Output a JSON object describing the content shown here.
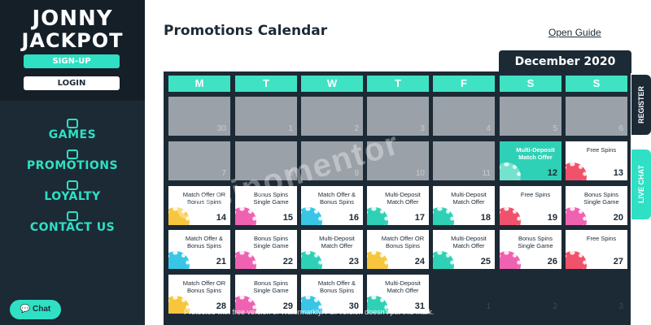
{
  "sidebar": {
    "logo_line1": "JONNY",
    "logo_line2": "JACKPOT",
    "signup_label": "SIGN-UP",
    "login_label": "LOGIN",
    "nav": [
      {
        "label": "GAMES",
        "icon": "cards-icon"
      },
      {
        "label": "PROMOTIONS",
        "icon": "gift-icon"
      },
      {
        "label": "LOYALTY",
        "icon": "trophy-icon"
      },
      {
        "label": "CONTACT US",
        "icon": "support-icon"
      }
    ],
    "chat_label": "Chat"
  },
  "header": {
    "title": "Promotions Calendar",
    "guide_link": "Open Guide",
    "month": "December 2020"
  },
  "weekdays": [
    "M",
    "T",
    "W",
    "T",
    "F",
    "S",
    "S"
  ],
  "calendar": [
    {
      "day": "30",
      "offer": "",
      "state": "past"
    },
    {
      "day": "1",
      "offer": "",
      "state": "past"
    },
    {
      "day": "2",
      "offer": "",
      "state": "past"
    },
    {
      "day": "3",
      "offer": "",
      "state": "past"
    },
    {
      "day": "4",
      "offer": "",
      "state": "past"
    },
    {
      "day": "5",
      "offer": "",
      "state": "past"
    },
    {
      "day": "6",
      "offer": "",
      "state": "past"
    },
    {
      "day": "7",
      "offer": "",
      "state": "past"
    },
    {
      "day": "8",
      "offer": "",
      "state": "past"
    },
    {
      "day": "9",
      "offer": "",
      "state": "past"
    },
    {
      "day": "10",
      "offer": "",
      "state": "past"
    },
    {
      "day": "11",
      "offer": "",
      "state": "past"
    },
    {
      "day": "12",
      "offer": "Multi-Deposit Match Offer",
      "state": "highlight",
      "chip": "#ffffff"
    },
    {
      "day": "13",
      "offer": "Free Spins",
      "state": "active",
      "chip": "#f0516b"
    },
    {
      "day": "14",
      "offer": "Match Offer OR Bonus Spins",
      "state": "active",
      "chip": "#f7c63c"
    },
    {
      "day": "15",
      "offer": "Bonus Spins Single Game",
      "state": "active",
      "chip": "#ef62b1"
    },
    {
      "day": "16",
      "offer": "Match Offer & Bonus Spins",
      "state": "active",
      "chip": "#39c6e6"
    },
    {
      "day": "17",
      "offer": "Multi-Deposit Match Offer",
      "state": "active",
      "chip": "#2fd1b6"
    },
    {
      "day": "18",
      "offer": "Multi-Deposit Match Offer",
      "state": "active",
      "chip": "#2fd1b6"
    },
    {
      "day": "19",
      "offer": "Free Spins",
      "state": "active",
      "chip": "#f0516b"
    },
    {
      "day": "20",
      "offer": "Bonus Spins Single Game",
      "state": "active",
      "chip": "#ef62b1"
    },
    {
      "day": "21",
      "offer": "Match Offer & Bonus Spins",
      "state": "active",
      "chip": "#39c6e6"
    },
    {
      "day": "22",
      "offer": "Bonus Spins Single Game",
      "state": "active",
      "chip": "#ef62b1"
    },
    {
      "day": "23",
      "offer": "Multi-Deposit Match Offer",
      "state": "active",
      "chip": "#2fd1b6"
    },
    {
      "day": "24",
      "offer": "Match Offer OR Bonus Spins",
      "state": "active",
      "chip": "#f7c63c"
    },
    {
      "day": "25",
      "offer": "Multi-Deposit Match Offer",
      "state": "active",
      "chip": "#2fd1b6"
    },
    {
      "day": "26",
      "offer": "Bonus Spins Single Game",
      "state": "active",
      "chip": "#ef62b1"
    },
    {
      "day": "27",
      "offer": "Free Spins",
      "state": "active",
      "chip": "#f0516b"
    },
    {
      "day": "28",
      "offer": "Match Offer OR Bonus Spins",
      "state": "active",
      "chip": "#f7c63c"
    },
    {
      "day": "29",
      "offer": "Bonus Spins Single Game",
      "state": "active",
      "chip": "#ef62b1"
    },
    {
      "day": "30",
      "offer": "Match Offer & Bonus Spins",
      "state": "active",
      "chip": "#39c6e6"
    },
    {
      "day": "31",
      "offer": "Multi-Deposit Match Offer",
      "state": "active",
      "chip": "#2fd1b6"
    },
    {
      "day": "1",
      "offer": "",
      "state": "empty"
    },
    {
      "day": "2",
      "offer": "",
      "state": "empty"
    },
    {
      "day": "3",
      "offer": "",
      "state": "empty"
    }
  ],
  "side_tabs": {
    "register": "REGISTER",
    "live_chat": "LIVE CHAT"
  },
  "watermark": {
    "logo": "casinomentor",
    "notice": "Protected with free version of Watermarkly. Full version doesn't put this mark."
  },
  "colors": {
    "accent": "#2fe0c4",
    "dark": "#1c2a36",
    "past_cell": "#9ba1a8"
  }
}
